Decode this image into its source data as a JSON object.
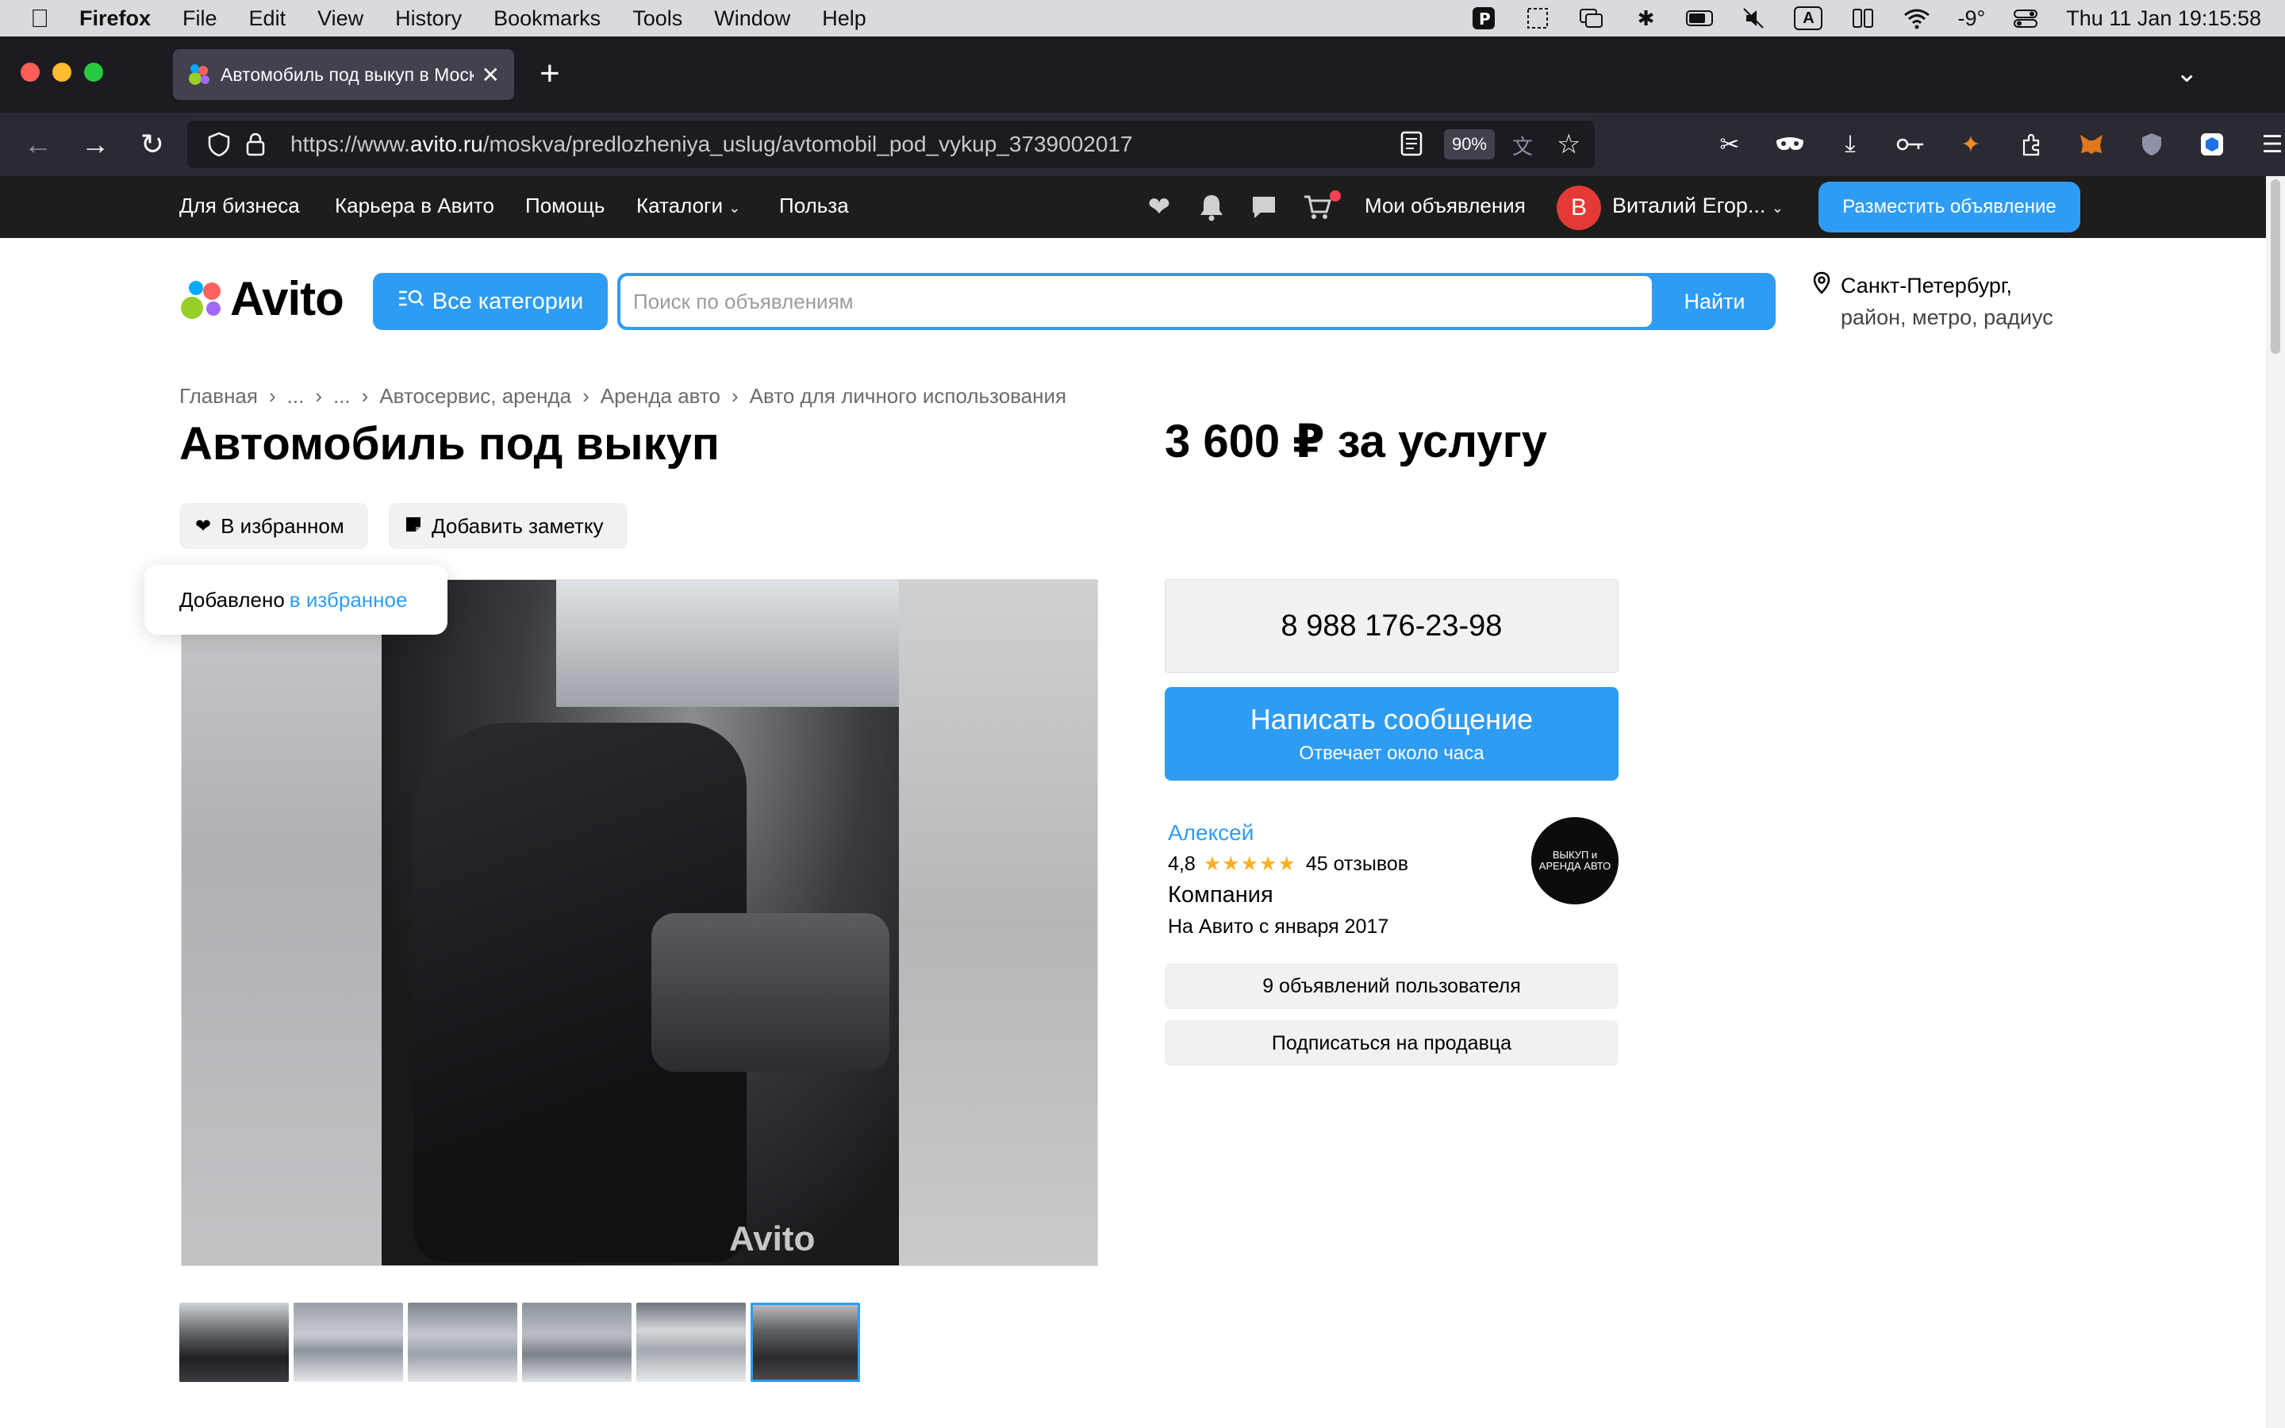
{
  "os_menubar": {
    "app": "Firefox",
    "items": [
      "File",
      "Edit",
      "View",
      "History",
      "Bookmarks",
      "Tools",
      "Window",
      "Help"
    ],
    "input_source": "A",
    "temperature": "-9°",
    "datetime": "Thu 11 Jan  19:15:58"
  },
  "browser": {
    "tab_title": "Автомобиль под выкуп в Москве",
    "url_prefix": "https://www.",
    "url_domain": "avito.ru",
    "url_path": "/moskva/predlozheniya_uslug/avtomobil_pod_vykup_3739002017",
    "zoom": "90%"
  },
  "avito_nav": {
    "links": [
      "Для бизнеса",
      "Карьера в Авито",
      "Помощь",
      "Каталоги",
      "Польза"
    ],
    "my_ads": "Мои объявления",
    "user_initial": "В",
    "user_name": "Виталий Егор...",
    "post_ad": "Разместить объявление"
  },
  "header": {
    "logo": "Avito",
    "all_categories": "Все категории",
    "search_placeholder": "Поиск по объявлениям",
    "search_button": "Найти",
    "location_city": "Санкт-Петербург,",
    "location_sub": "район, метро, радиус"
  },
  "breadcrumb": [
    "Главная",
    "...",
    "...",
    "Автосервис, аренда",
    "Аренда авто",
    "Авто для личного использования"
  ],
  "listing": {
    "title": "Автомобиль под выкуп",
    "price": "3 600 ₽ за услугу",
    "favorite_label": "В избранном",
    "note_label": "Добавить заметку",
    "toast_text": "Добавлено",
    "toast_link": "в избранное",
    "watermark": "Avito"
  },
  "contact": {
    "phone": "8 988 176-23-98",
    "message_button": "Написать сообщение",
    "message_sub": "Отвечает около часа"
  },
  "seller": {
    "name": "Алексей",
    "rating": "4,8",
    "stars": "★★★★★",
    "reviews": "45 отзывов",
    "type": "Компания",
    "since": "На Авито с января 2017",
    "logo_text": "ВЫКУП и АРЕНДА АВТО",
    "ads_button": "9 объявлений пользователя",
    "subscribe_button": "Подписаться на продавца"
  },
  "colors": {
    "accent": "#2f9cf4",
    "dark_nav": "#1d1d1d",
    "chip_bg": "#f2f1f0",
    "stars": "#ffb021"
  }
}
